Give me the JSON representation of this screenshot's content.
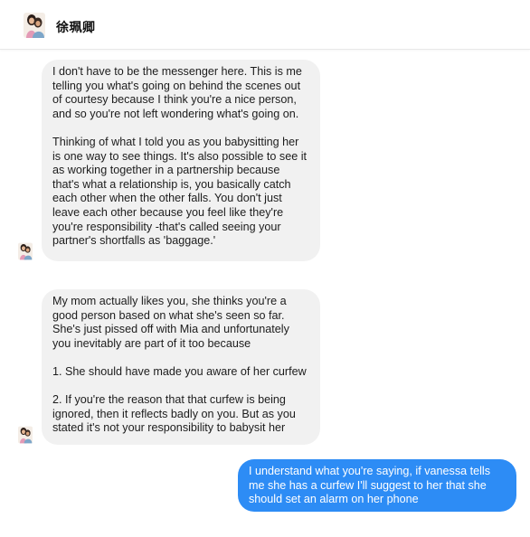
{
  "header": {
    "contact_name": "徐珮卿",
    "avatar_icon": "contact-avatar-photo"
  },
  "messages": [
    {
      "sender": "contact",
      "paragraphs": [
        "I don't have to be the messenger here. This is me telling you what's going on behind the scenes out of courtesy because I think you're a nice person, and so you're not left wondering what's going on.",
        "Thinking of what I told you as you babysitting her is one way to see things. It's also possible to see it as working together in a partnership because that's what a relationship is, you basically catch each other when the other falls. You don't just leave each other because you feel like they're you're responsibility -that's called seeing your partner's shortfalls as 'baggage.'"
      ]
    },
    {
      "sender": "contact",
      "paragraphs": [
        "My mom actually likes you, she thinks you're a good person based on what she's seen so far. She's just pissed off with Mia and unfortunately you inevitably are part of it too because",
        "1. She should have made you aware of her curfew",
        "2. If you're the reason that that curfew is being ignored, then it reflects badly on you. But as you stated it's not your responsibility to babysit her"
      ]
    },
    {
      "sender": "me",
      "paragraphs": [
        "I understand what you're saying, if vanessa tells me she has a curfew I'll suggest to her that she should set an alarm on her phone"
      ]
    }
  ],
  "colors": {
    "incoming_bubble": "#f1f1f1",
    "outgoing_bubble": "#2d8cf5"
  }
}
